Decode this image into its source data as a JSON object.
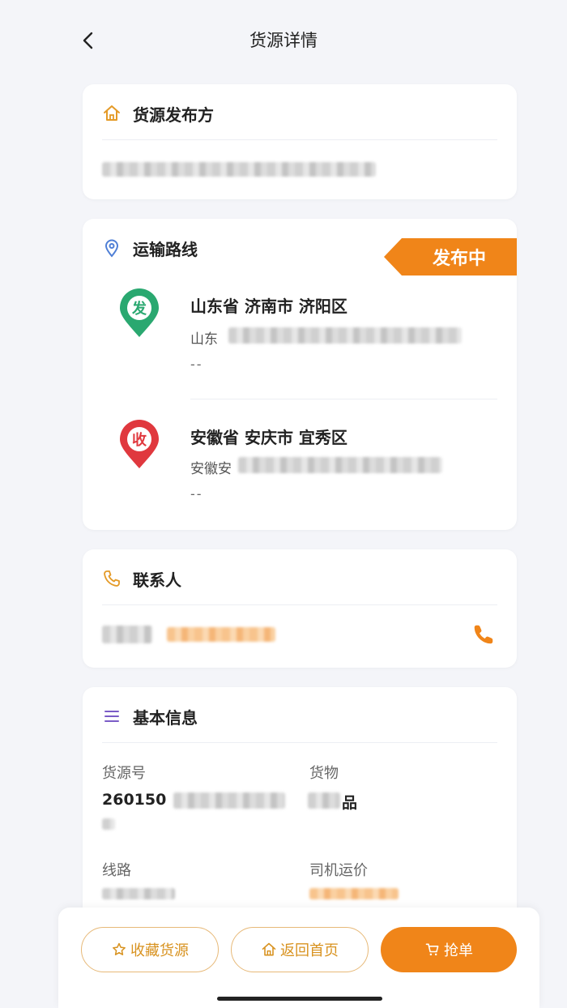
{
  "header": {
    "title": "货源详情"
  },
  "publisher": {
    "title": "货源发布方"
  },
  "route": {
    "title": "运输路线",
    "status": "发布中",
    "origin": {
      "badge": "发",
      "region": "山东省 济南市 济阳区",
      "address_visible": "山东",
      "extra": "--",
      "color": "#2aa870"
    },
    "destination": {
      "badge": "收",
      "region": "安徽省 安庆市 宜秀区",
      "address_visible": "安徽安",
      "extra": "--",
      "color": "#e0383e"
    }
  },
  "contact": {
    "title": "联系人",
    "phone_icon": "phone-icon"
  },
  "basic": {
    "title": "基本信息",
    "cargo_no_label": "货源号",
    "cargo_no_value": "260150",
    "goods_label": "货物",
    "goods_value": "品",
    "route_label": "线路",
    "price_label": "司机运价"
  },
  "actions": {
    "favorite": "收藏货源",
    "home": "返回首页",
    "grab": "抢单"
  },
  "colors": {
    "accent": "#f08519",
    "icon_orange": "#e49a27",
    "pin_green": "#2aa870",
    "pin_red": "#e0383e",
    "purple": "#7b5cc7",
    "location_blue": "#4f7fd6"
  }
}
